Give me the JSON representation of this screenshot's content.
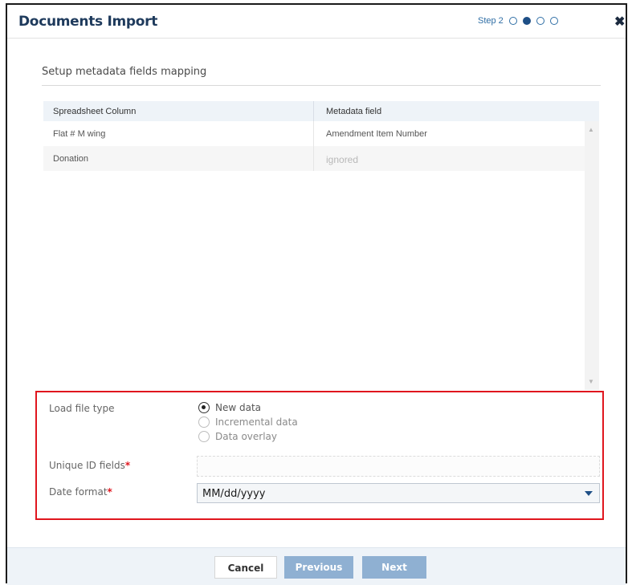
{
  "dialog": {
    "title": "Documents Import",
    "step_label": "Step 2",
    "steps_total": 4,
    "current_step": 2
  },
  "section": {
    "title": "Setup metadata fields mapping"
  },
  "grid": {
    "columns": [
      "Spreadsheet Column",
      "Metadata field"
    ],
    "rows": [
      {
        "column": "Flat # M wing",
        "field": "Amendment Item Number"
      },
      {
        "column": "Donation",
        "field": "ignored"
      }
    ]
  },
  "options": {
    "load_file_type_label": "Load file type",
    "load_file_types": [
      "New data",
      "Incremental data",
      "Data overlay"
    ],
    "selected_load_file_type": "New data",
    "unique_id_label": "Unique ID fields",
    "unique_id_value": "",
    "date_format_label": "Date format",
    "date_format_value": "MM/dd/yyyy",
    "required_marker": "*"
  },
  "footer": {
    "cancel_label": "Cancel",
    "previous_label": "Previous",
    "next_label": "Next"
  },
  "colors": {
    "title": "#1e3a5c",
    "accent": "#1e4f86",
    "button_disabled": "#8fb0d2",
    "highlight_border": "#e0161e"
  }
}
